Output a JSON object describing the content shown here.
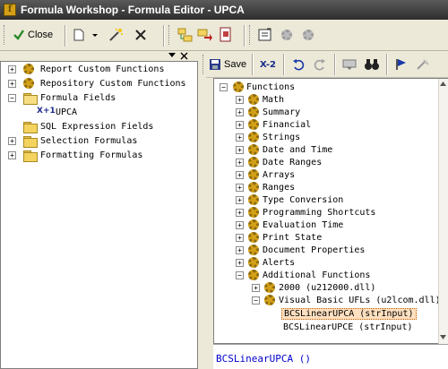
{
  "window": {
    "title": "Formula Workshop - Formula Editor - UPCA"
  },
  "toolbar": {
    "close_label": "Close"
  },
  "right_toolbar": {
    "save_label": "Save",
    "check_label": "X-2"
  },
  "left_tree": {
    "items": [
      {
        "label": "Report Custom Functions"
      },
      {
        "label": "Repository Custom Functions"
      },
      {
        "label": "Formula Fields"
      },
      {
        "label": "UPCA",
        "badge": "X+1"
      },
      {
        "label": "SQL Expression Fields"
      },
      {
        "label": "Selection Formulas"
      },
      {
        "label": "Formatting Formulas"
      }
    ]
  },
  "function_tree": {
    "items": [
      {
        "label": "Functions"
      },
      {
        "label": "Math"
      },
      {
        "label": "Summary"
      },
      {
        "label": "Financial"
      },
      {
        "label": "Strings"
      },
      {
        "label": "Date and Time"
      },
      {
        "label": "Date Ranges"
      },
      {
        "label": "Arrays"
      },
      {
        "label": "Ranges"
      },
      {
        "label": "Type Conversion"
      },
      {
        "label": "Programming Shortcuts"
      },
      {
        "label": "Evaluation Time"
      },
      {
        "label": "Print State"
      },
      {
        "label": "Document Properties"
      },
      {
        "label": "Alerts"
      },
      {
        "label": "Additional Functions"
      },
      {
        "label": "2000 (u212000.dll)"
      },
      {
        "label": "Visual Basic UFLs (u2lcom.dll)"
      },
      {
        "label": "BCSLinearUPCA (strInput)"
      },
      {
        "label": "BCSLinearUPCE (strInput)"
      }
    ]
  },
  "editor": {
    "text": "BCSLinearUPCA ()"
  },
  "colors": {
    "title_bar": "#3a3a3a",
    "selection": "#ffe0c0",
    "code_text": "#0000cc"
  }
}
